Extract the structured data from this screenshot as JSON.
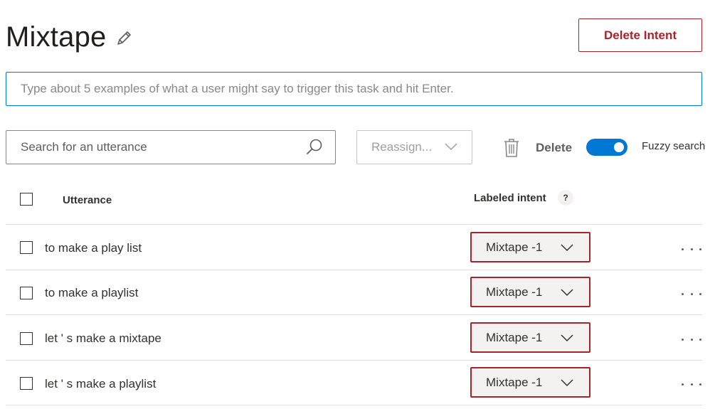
{
  "header": {
    "title": "Mixtape",
    "delete_intent_label": "Delete Intent"
  },
  "example_input": {
    "placeholder": "Type about 5 examples of what a user might say to trigger this task and hit Enter.",
    "value": ""
  },
  "toolbar": {
    "search_placeholder": "Search for an utterance",
    "reassign_label": "Reassign...",
    "delete_label": "Delete",
    "fuzzy_search_label": "Fuzzy search",
    "fuzzy_search_on": true
  },
  "table": {
    "columns": {
      "utterance": "Utterance",
      "labeled_intent": "Labeled intent",
      "help": "?"
    },
    "rows": [
      {
        "utterance": "to make a play list",
        "intent": "Mixtape -1"
      },
      {
        "utterance": "to make a playlist",
        "intent": "Mixtape -1"
      },
      {
        "utterance": "let ' s make a mixtape",
        "intent": "Mixtape -1"
      },
      {
        "utterance": "let ' s make a playlist",
        "intent": "Mixtape -1"
      }
    ]
  },
  "icons": {
    "edit": "pencil-icon",
    "search": "search-icon",
    "reassign_dropdown": "chevron-down-icon",
    "delete": "trash-icon",
    "row_intent_dropdown": "chevron-down-icon",
    "row_more": "more-horizontal-icon"
  },
  "colors": {
    "accent": "#0078d4",
    "danger": "#a4262c",
    "divider": "#e1dfdd",
    "dropdown_bg": "#f3f2f1"
  }
}
